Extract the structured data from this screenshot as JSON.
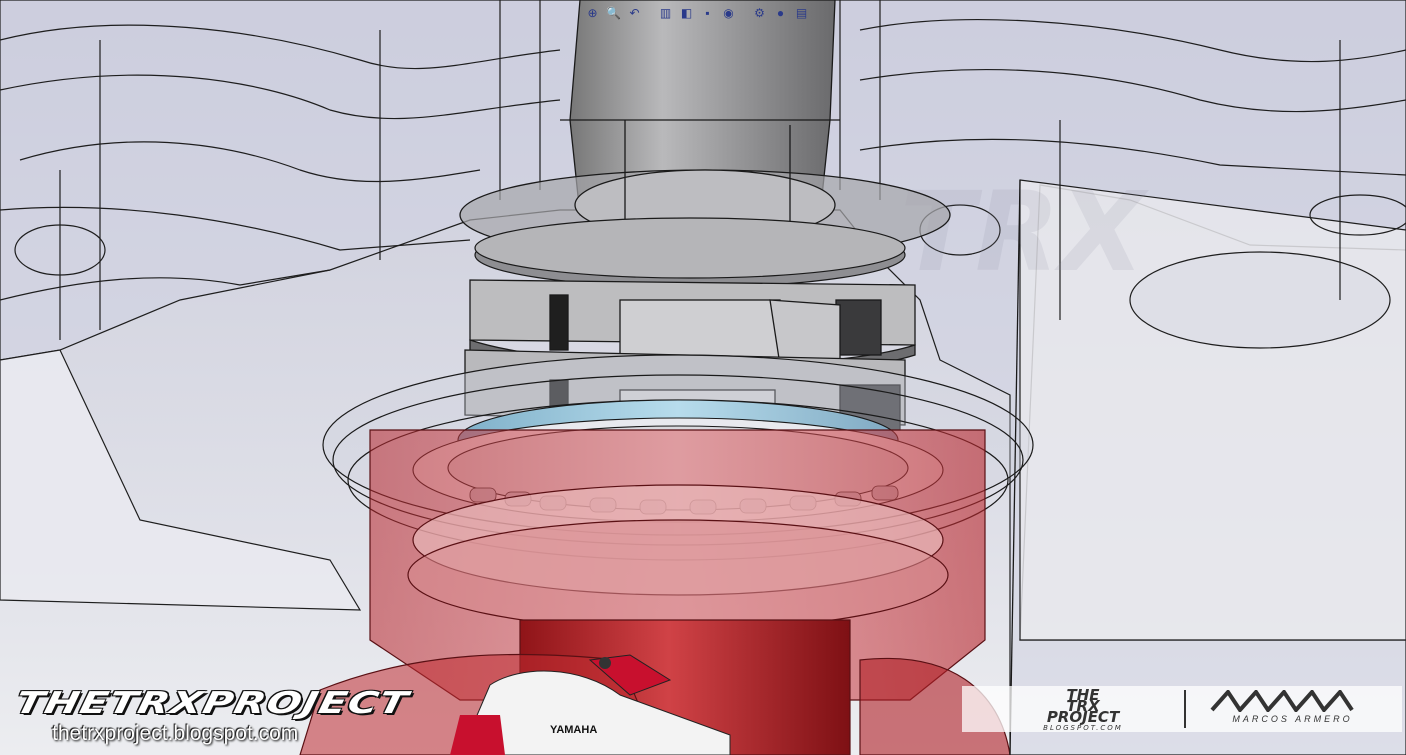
{
  "viewport": {
    "model": "steering-head-assembly",
    "colors": {
      "background": "#dcdde6",
      "ghost_part": "#d4d6e4",
      "bearing_blue": "#9ccbe0",
      "lower_part_red": "#c8262c",
      "nut_gray": "#8a8a8a",
      "edges": "#1a1a1a"
    },
    "faded_watermark": "TRX"
  },
  "toolbar": {
    "items": [
      {
        "icon": "zoom-to-fit-icon",
        "glyph": "⊕"
      },
      {
        "icon": "zoom-to-area-icon",
        "glyph": "🔍"
      },
      {
        "icon": "previous-view-icon",
        "glyph": "↶"
      },
      {
        "icon": "section-view-icon",
        "glyph": "▥"
      },
      {
        "icon": "view-orientation-icon",
        "glyph": "◧"
      },
      {
        "icon": "display-style-icon",
        "glyph": "▪"
      },
      {
        "icon": "hide-show-items-icon",
        "glyph": "◉"
      },
      {
        "icon": "edit-appearance-icon",
        "glyph": "⚙"
      },
      {
        "icon": "apply-scene-icon",
        "glyph": "●"
      },
      {
        "icon": "view-settings-icon",
        "glyph": "▤"
      }
    ]
  },
  "watermark_left": {
    "brand": "THETRXPROJECT",
    "url": "thetrxproject.blogspot.com",
    "bike_logo": "YAMAHA"
  },
  "watermark_right": {
    "logo_line1": "THE",
    "logo_line2": "TRX",
    "logo_line3": "PROJECT",
    "logo_sub": "BLOGSPOT.COM",
    "author": "MARCOS ARMERO"
  }
}
